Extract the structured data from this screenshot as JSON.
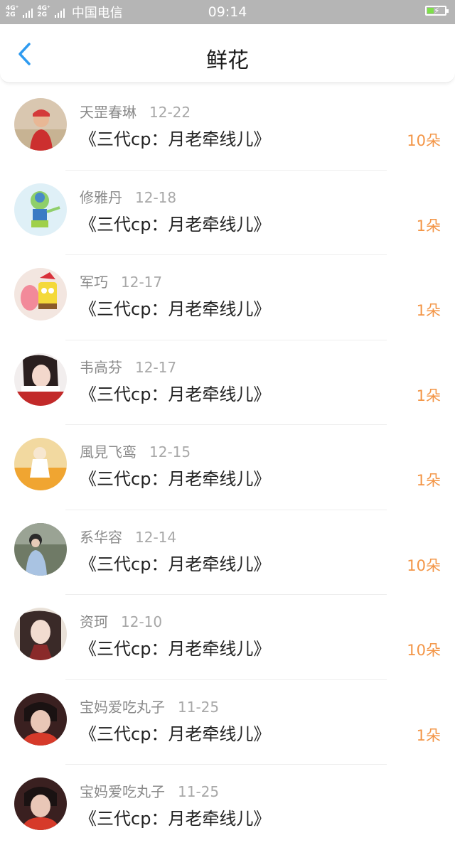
{
  "status_bar": {
    "network_label_top": "4G⁺",
    "network_label_bottom": "2G",
    "network_label_top_2": "4G⁺",
    "network_label_bottom_2": "2G",
    "carrier": "中国电信",
    "time": "09:14",
    "battery_color": "#7ee04a"
  },
  "nav": {
    "title": "鲜花",
    "back_icon": "chevron-left-icon",
    "accent": "#2f9bf0"
  },
  "items": [
    {
      "name": "天罡春琳",
      "date": "12-22",
      "book": "《三代cp：月老牵线儿》",
      "count": "10朵"
    },
    {
      "name": "修雅丹",
      "date": "12-18",
      "book": "《三代cp：月老牵线儿》",
      "count": "1朵"
    },
    {
      "name": "军巧",
      "date": "12-17",
      "book": "《三代cp：月老牵线儿》",
      "count": "1朵"
    },
    {
      "name": "韦高芬",
      "date": "12-17",
      "book": "《三代cp：月老牵线儿》",
      "count": "1朵"
    },
    {
      "name": "風見飞鸾",
      "date": "12-15",
      "book": "《三代cp：月老牵线儿》",
      "count": "1朵"
    },
    {
      "name": "系华容",
      "date": "12-14",
      "book": "《三代cp：月老牵线儿》",
      "count": "10朵"
    },
    {
      "name": "资珂",
      "date": "12-10",
      "book": "《三代cp：月老牵线儿》",
      "count": "10朵"
    },
    {
      "name": "宝妈爱吃丸子",
      "date": "11-25",
      "book": "《三代cp：月老牵线儿》",
      "count": "1朵"
    },
    {
      "name": "宝妈爱吃丸子",
      "date": "11-25",
      "book": "《三代cp：月老牵线儿》",
      "count": ""
    }
  ],
  "colors": {
    "count": "#f39546",
    "name": "#8a8a8a",
    "date": "#a8a8a8",
    "title": "#1a1a1a"
  }
}
